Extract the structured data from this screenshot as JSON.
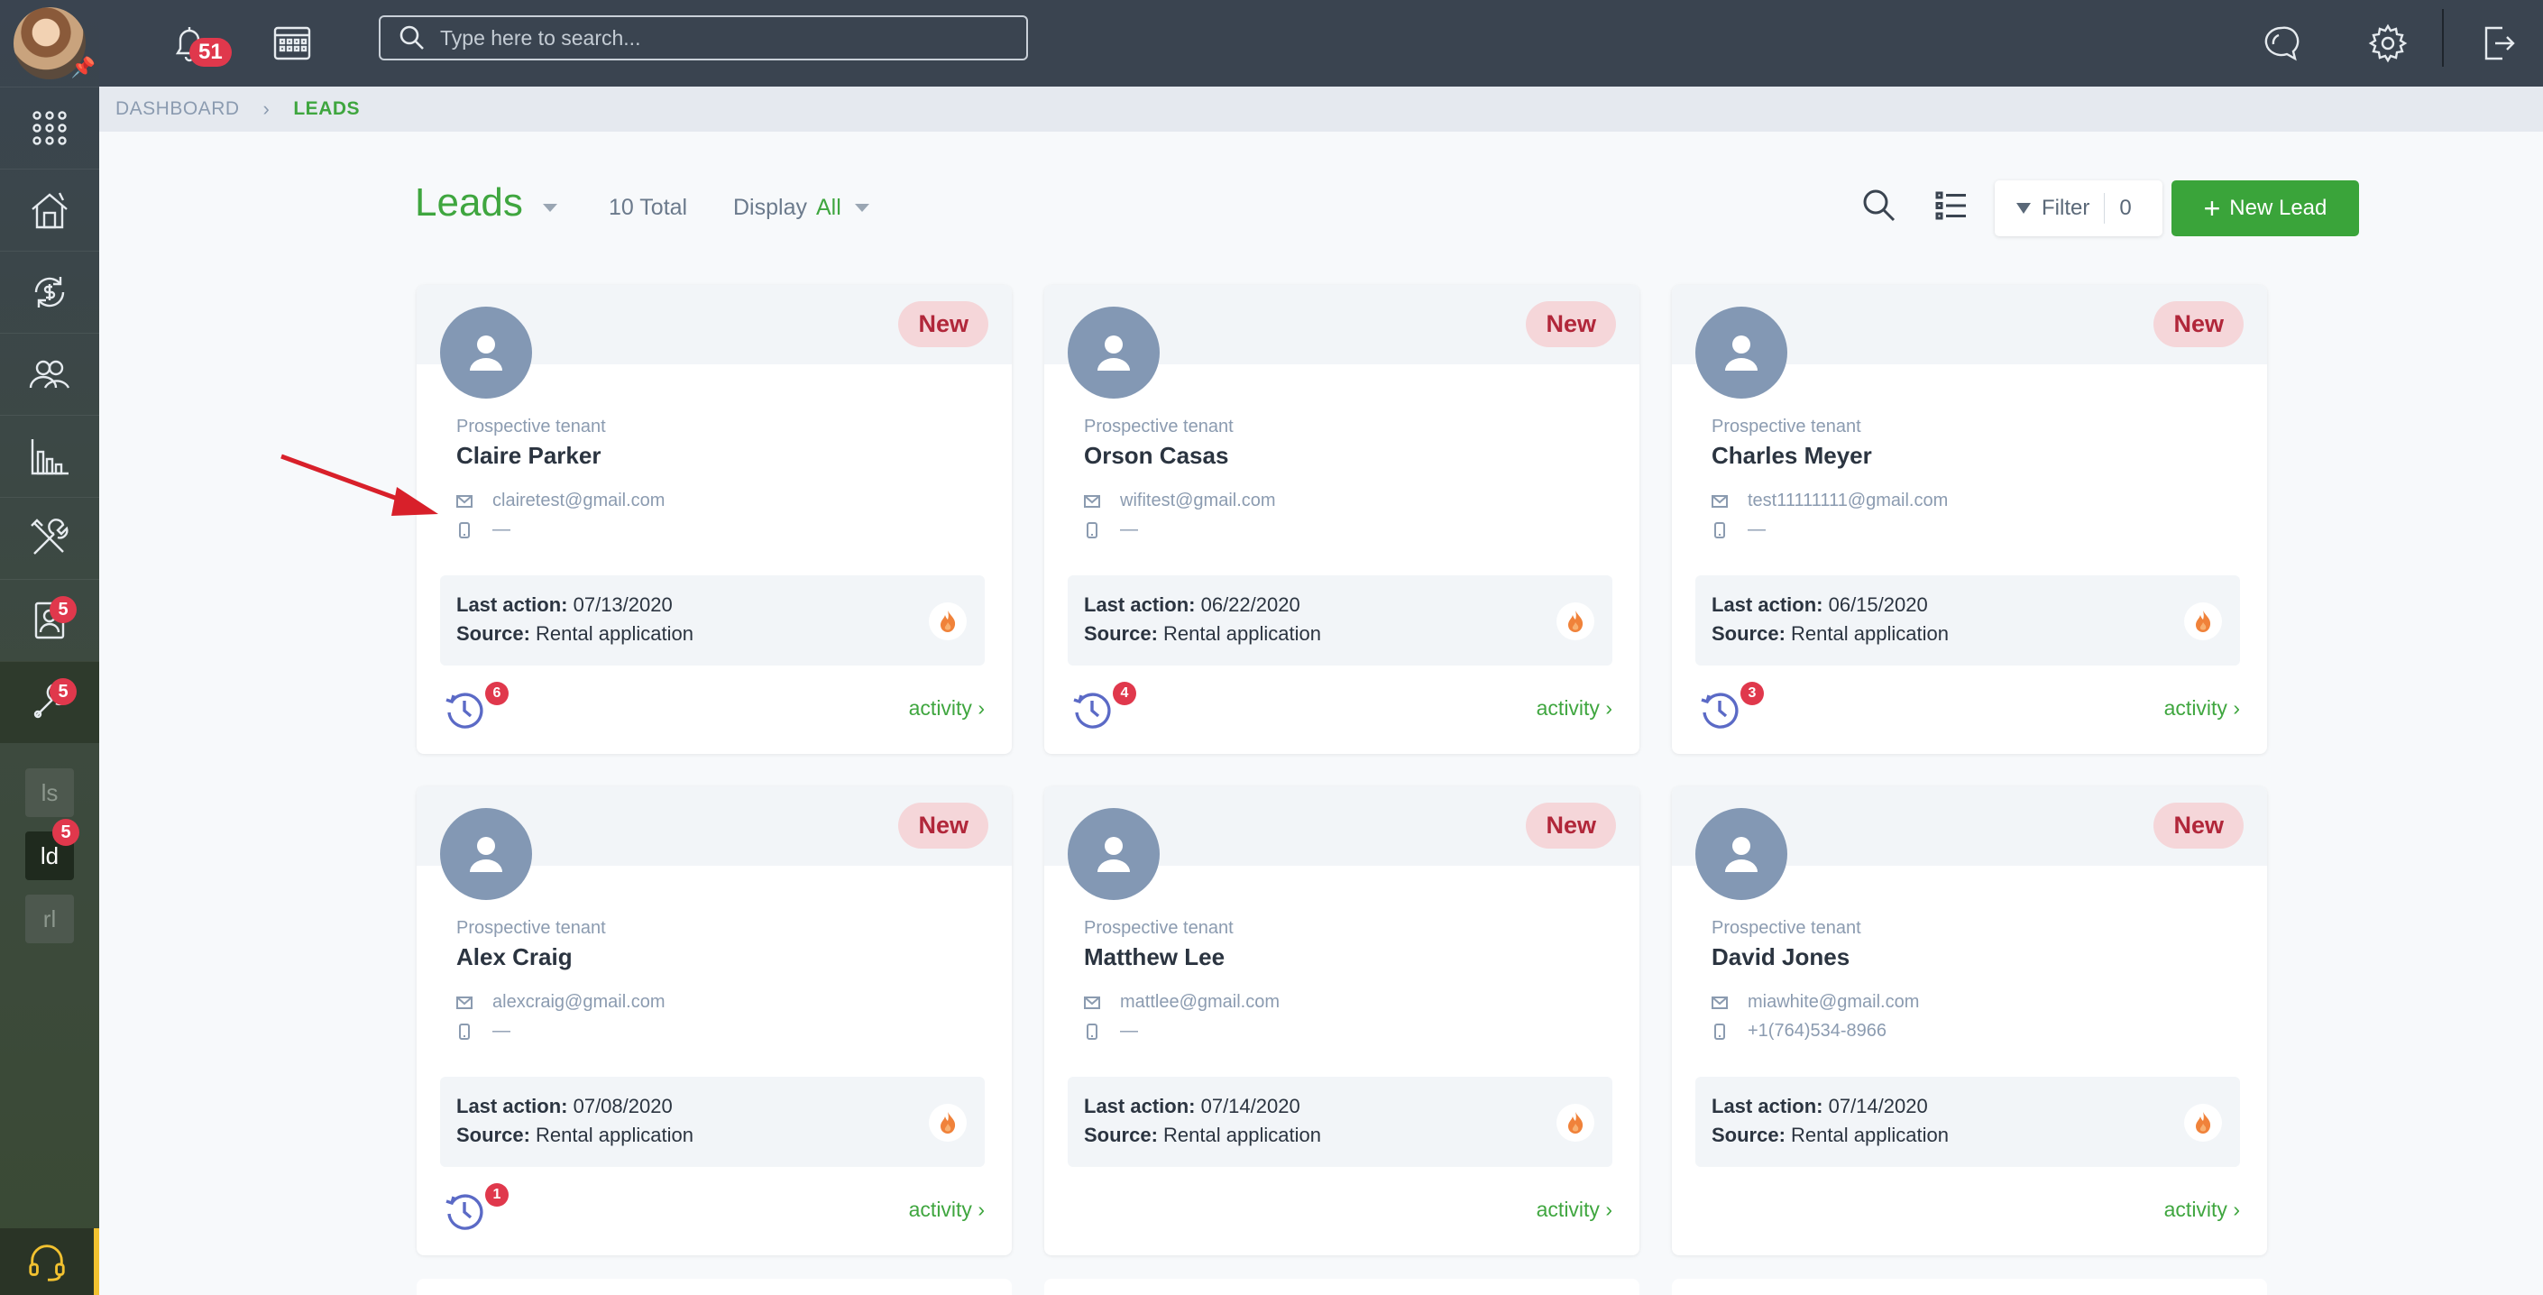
{
  "topbar": {
    "bell_count": "51",
    "search_placeholder": "Type here to search..."
  },
  "sidebar": {
    "badges": {
      "applications": "5",
      "maintenance": "5",
      "ld": "5"
    },
    "mini_items": [
      {
        "label": "ls"
      },
      {
        "label": "ld"
      },
      {
        "label": "rl"
      }
    ]
  },
  "breadcrumb": {
    "root": "DASHBOARD",
    "current": "LEADS"
  },
  "header": {
    "title": "Leads",
    "total": "10 Total",
    "display_label": "Display",
    "display_value": "All",
    "filter_label": "Filter",
    "filter_count": "0",
    "new_lead_label": "New Lead"
  },
  "leads": [
    {
      "badge": "New",
      "role": "Prospective tenant",
      "name": "Claire Parker",
      "email": "clairetest@gmail.com",
      "phone": "—",
      "last_action_label": "Last action:",
      "last_action": "07/13/2020",
      "source_label": "Source:",
      "source": "Rental application",
      "activity_count": "6",
      "activity_label": "activity"
    },
    {
      "badge": "New",
      "role": "Prospective tenant",
      "name": "Orson Casas",
      "email": "wifitest@gmail.com",
      "phone": "—",
      "last_action_label": "Last action:",
      "last_action": "06/22/2020",
      "source_label": "Source:",
      "source": "Rental application",
      "activity_count": "4",
      "activity_label": "activity"
    },
    {
      "badge": "New",
      "role": "Prospective tenant",
      "name": "Charles Meyer",
      "email": "test11111111@gmail.com",
      "phone": "—",
      "last_action_label": "Last action:",
      "last_action": "06/15/2020",
      "source_label": "Source:",
      "source": "Rental application",
      "activity_count": "3",
      "activity_label": "activity"
    },
    {
      "badge": "New",
      "role": "Prospective tenant",
      "name": "Alex Craig",
      "email": "alexcraig@gmail.com",
      "phone": "—",
      "last_action_label": "Last action:",
      "last_action": "07/08/2020",
      "source_label": "Source:",
      "source": "Rental application",
      "activity_count": "1",
      "activity_label": "activity"
    },
    {
      "badge": "New",
      "role": "Prospective tenant",
      "name": "Matthew Lee",
      "email": "mattlee@gmail.com",
      "phone": "—",
      "last_action_label": "Last action:",
      "last_action": "07/14/2020",
      "source_label": "Source:",
      "source": "Rental application",
      "activity_label": "activity"
    },
    {
      "badge": "New",
      "role": "Prospective tenant",
      "name": "David Jones",
      "email": "miawhite@gmail.com",
      "phone": "+1(764)534-8966",
      "last_action_label": "Last action:",
      "last_action": "07/14/2020",
      "source_label": "Source:",
      "source": "Rental application",
      "activity_label": "activity"
    }
  ],
  "colors": {
    "accent_green": "#3fa63f",
    "badge_red": "#e0384c",
    "nav_dark": "#3a4450",
    "new_badge_bg": "#f5d6d9",
    "annotation_arrow": "#d8202a"
  }
}
